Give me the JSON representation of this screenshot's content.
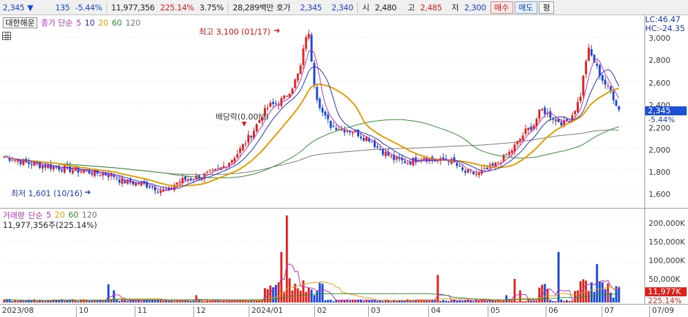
{
  "ticker": {
    "price": "2,345",
    "change_symbol": "▼",
    "change": "135",
    "change_pct": "-5.44%",
    "volume": "11,977,356",
    "volume_ratio": "225.14%",
    "turnover": "3.75%",
    "amount": "28,289백만",
    "quote_label": "호가",
    "ask": "2,345",
    "bid": "2,340",
    "open_label": "시",
    "open": "2,480",
    "high_label": "고",
    "high": "2,485",
    "low_label": "저",
    "low": "2,300",
    "buy_label": "매수",
    "sell_label": "매도",
    "avg_label": "평"
  },
  "price_legend": {
    "company": "대한해운",
    "type": "종가 단순",
    "ma5": "5",
    "ma10": "10",
    "ma20": "20",
    "ma60": "60",
    "ma120": "120"
  },
  "annotations": {
    "high": "최고 3,100 (01/17)",
    "low": "최저 1,601 (10/16)",
    "dividend": "배당락(0.00%)"
  },
  "right_panel": {
    "lc": "LC:46.47",
    "hc": "HC:-24.35",
    "current_price": "2,345",
    "current_change": "-5.44%",
    "current_volume": "11,977K",
    "current_volume_ratio": "225.14%"
  },
  "price_axis": [
    "3,000",
    "2,800",
    "2,600",
    "2,400",
    "2,200",
    "2,000",
    "1,800",
    "1,600"
  ],
  "volume_legend": {
    "label": "거래량",
    "type": "단순",
    "ma5": "5",
    "ma20": "20",
    "ma60": "60",
    "ma120": "120"
  },
  "volume_value": "11,977,356주(225.14%)",
  "volume_axis": [
    "200,000K",
    "150,000K",
    "100,000K",
    "50,000K"
  ],
  "x_axis": [
    "2023/08",
    "10",
    "11",
    "12",
    "2024/01",
    "02",
    "03",
    "04",
    "05",
    "06",
    "07",
    "07/09"
  ],
  "colors": {
    "up": "#e0211b",
    "down": "#1846d6",
    "ma5": "#c22fc2",
    "ma10": "#1a2fd0",
    "ma20": "#e59b00",
    "ma60": "#2d8f2d",
    "ma120": "#777777"
  },
  "chart_data": {
    "type": "candlestick",
    "price_range": [
      1500,
      3100
    ],
    "volume_range": [
      0,
      215000
    ],
    "close_series": [
      1920,
      1900,
      1880,
      1860,
      1850,
      1840,
      1830,
      1820,
      1810,
      1800,
      1790,
      1780,
      1770,
      1760,
      1750,
      1700,
      1690,
      1680,
      1670,
      1650,
      1620,
      1601,
      1680,
      1710,
      1720,
      1740,
      1760,
      1780,
      1820,
      1880,
      1950,
      2050,
      2150,
      2280,
      2380,
      2400,
      2450,
      2550,
      2700,
      3100,
      2500,
      2300,
      2200,
      2180,
      2160,
      2150,
      2100,
      2080,
      2000,
      1950,
      1900,
      1880,
      1870,
      1900,
      1920,
      1890,
      1880,
      1900,
      1850,
      1780,
      1770,
      1760,
      1800,
      1840,
      1900,
      1960,
      2050,
      2150,
      2200,
      2350,
      2300,
      2250,
      2220,
      2300,
      2450,
      2900,
      2750,
      2600,
      2500,
      2345
    ]
  }
}
